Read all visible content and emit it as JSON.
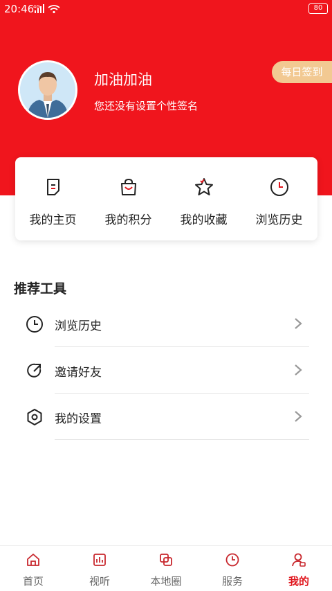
{
  "status_bar": {
    "time": "20:46",
    "network": "4G",
    "battery": "80"
  },
  "profile": {
    "name": "加油加油",
    "signature": "您还没有设置个性签名",
    "checkin_label": "每日签到"
  },
  "quick_actions": [
    {
      "label": "我的主页",
      "icon": "profile-page-icon"
    },
    {
      "label": "我的积分",
      "icon": "shopping-bag-icon"
    },
    {
      "label": "我的收藏",
      "icon": "star-icon"
    },
    {
      "label": "浏览历史",
      "icon": "clock-icon"
    }
  ],
  "tools": {
    "title": "推荐工具",
    "items": [
      {
        "label": "浏览历史",
        "icon": "clock-icon"
      },
      {
        "label": "邀请好友",
        "icon": "share-icon"
      },
      {
        "label": "我的设置",
        "icon": "settings-icon"
      }
    ]
  },
  "tabbar": [
    {
      "label": "首页",
      "icon": "home-icon"
    },
    {
      "label": "视听",
      "icon": "audio-video-icon"
    },
    {
      "label": "本地圈",
      "icon": "local-circle-icon"
    },
    {
      "label": "服务",
      "icon": "service-icon"
    },
    {
      "label": "我的",
      "icon": "user-icon",
      "active": true
    }
  ],
  "colors": {
    "brand_red": "#f0151d",
    "active_tab": "#e0151c",
    "checkin_bg": "#f2c992",
    "icon_red": "#e0151c"
  }
}
